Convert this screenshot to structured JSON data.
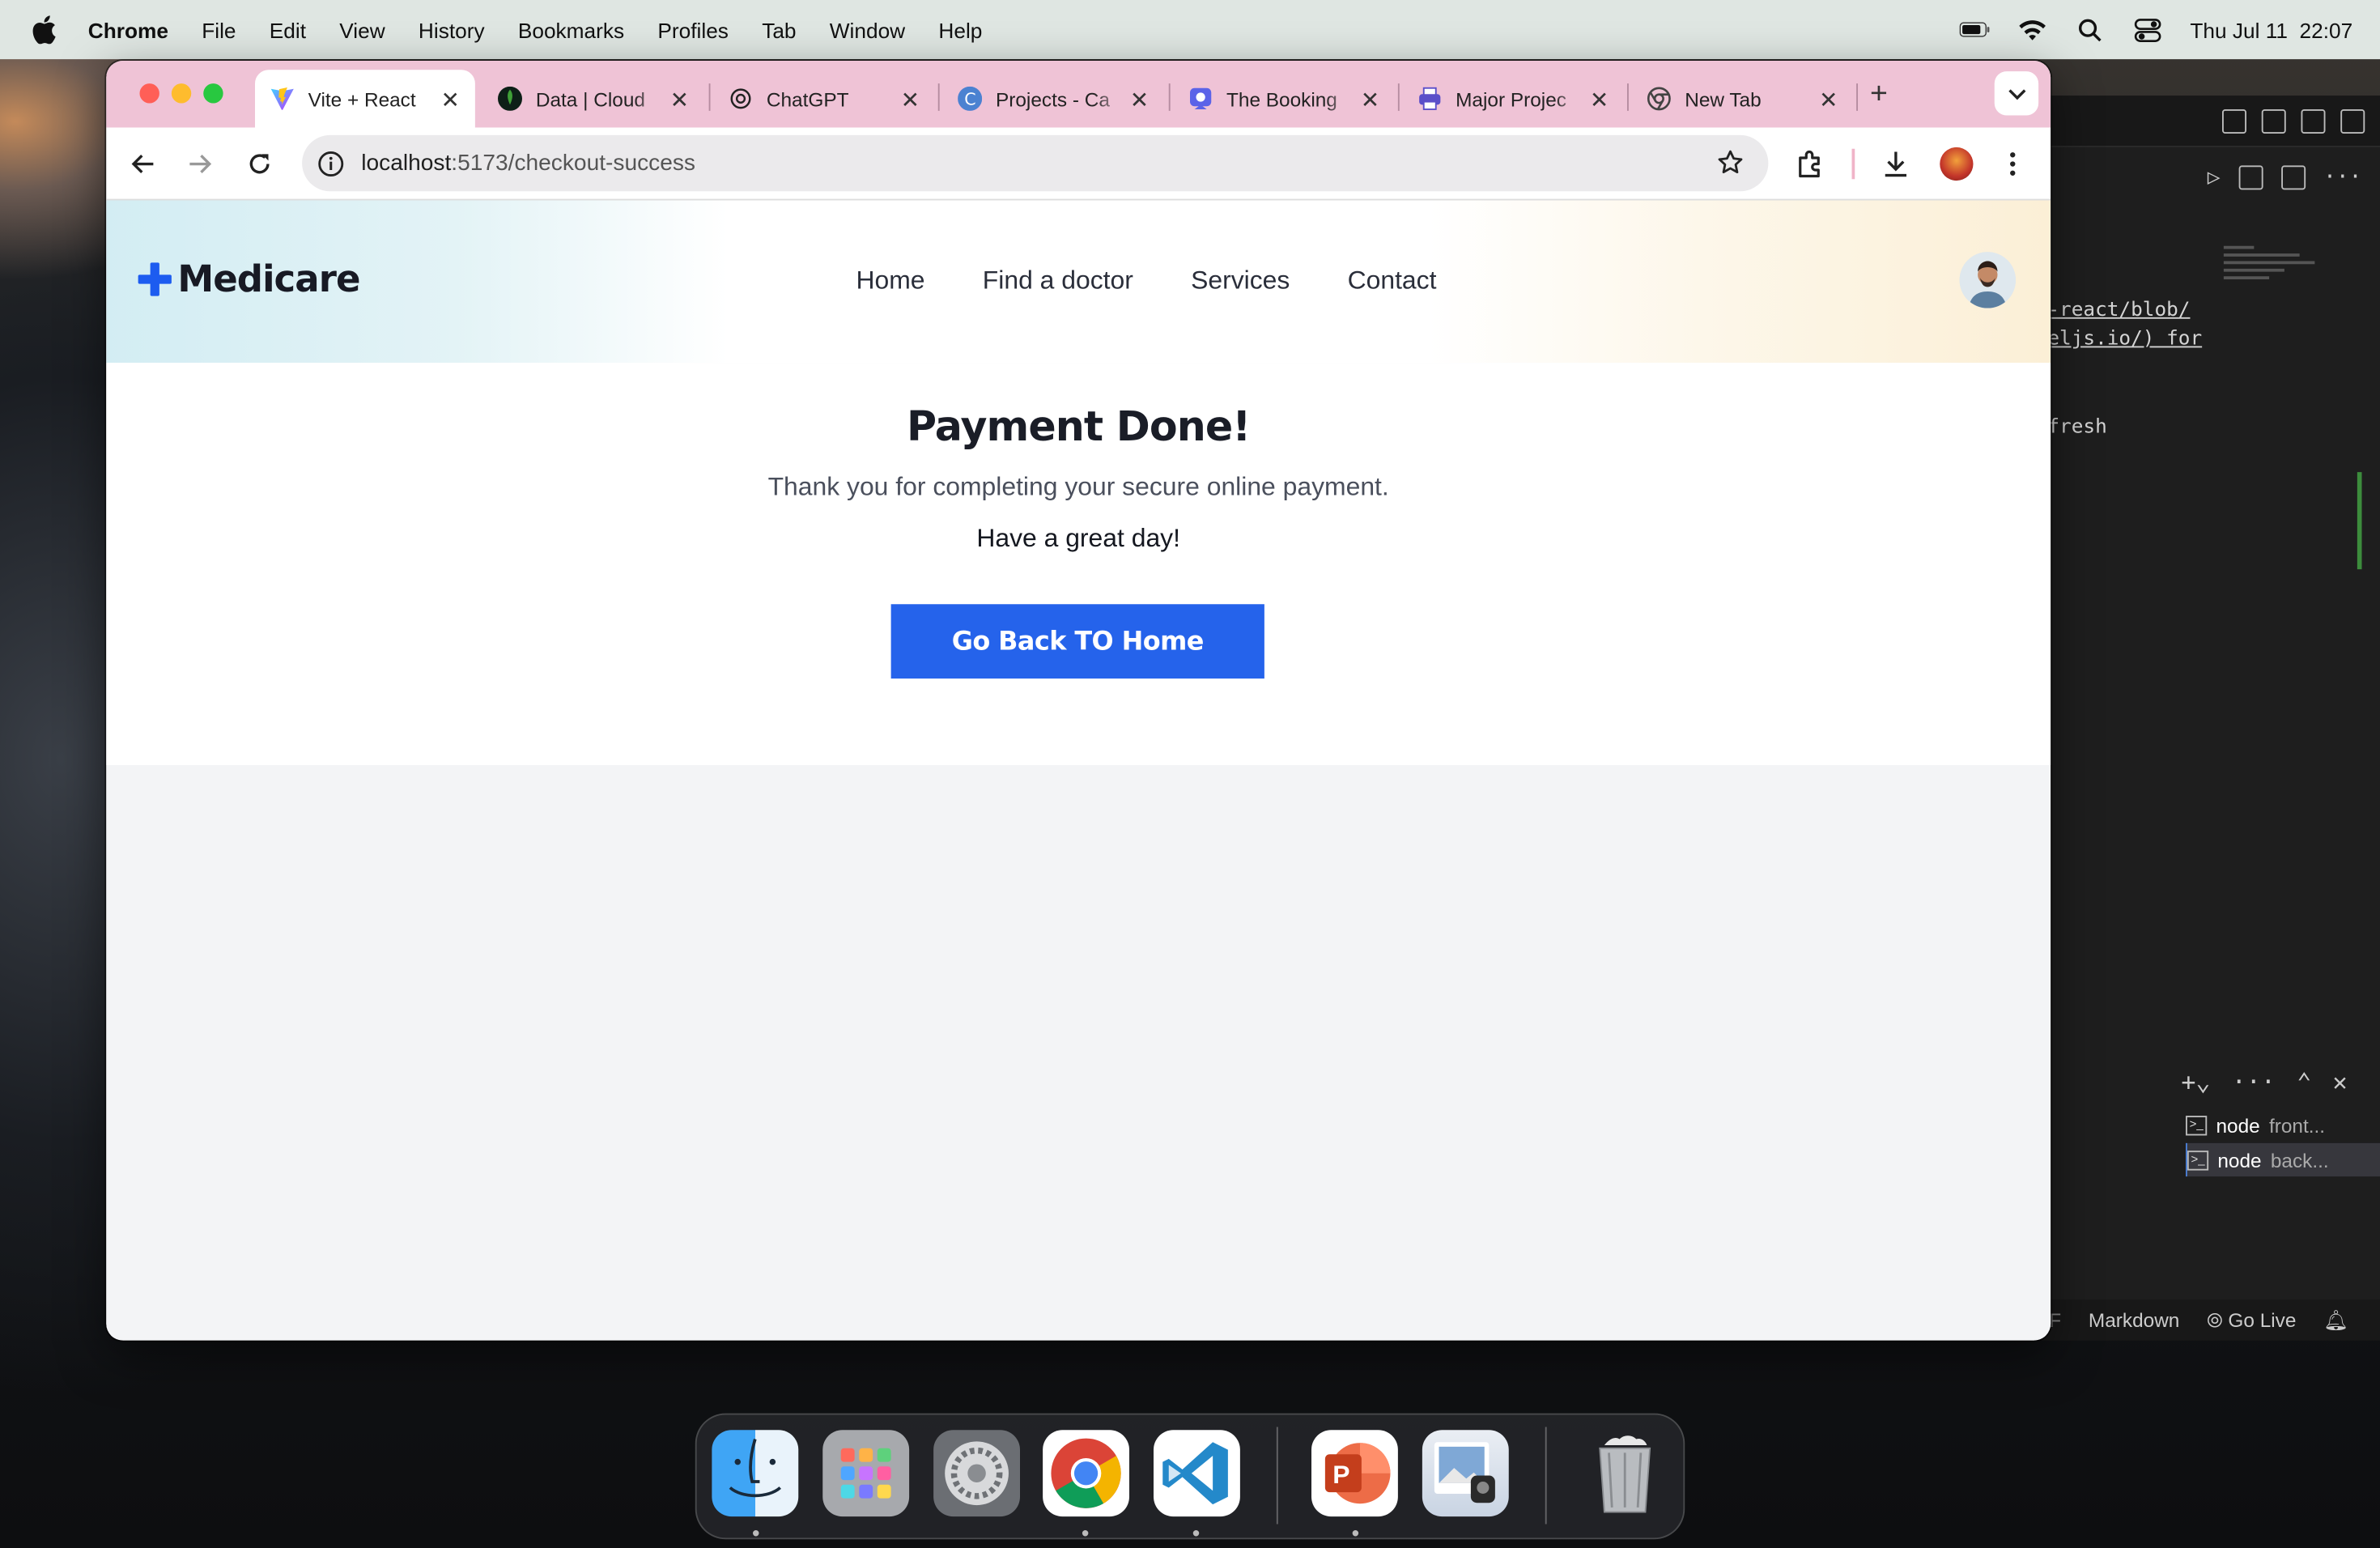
{
  "menubar": {
    "app_name": "Chrome",
    "items": [
      "File",
      "Edit",
      "View",
      "History",
      "Bookmarks",
      "Profiles",
      "Tab",
      "Window",
      "Help"
    ],
    "clock": "Thu Jul 11  22:07"
  },
  "browser": {
    "tabs": [
      {
        "title": "Vite + React",
        "icon": "vite-icon",
        "active": true
      },
      {
        "title": "Data | Cloud",
        "icon": "mongodb-leaf-icon",
        "active": false
      },
      {
        "title": "ChatGPT",
        "icon": "chatgpt-icon",
        "active": false
      },
      {
        "title": "Projects - Ca",
        "icon": "canva-icon",
        "active": false
      },
      {
        "title": "The Booking",
        "icon": "booking-icon",
        "active": false
      },
      {
        "title": "Major Projec",
        "icon": "printer-icon",
        "active": false
      },
      {
        "title": "New Tab",
        "icon": "chrome-icon",
        "active": false
      }
    ],
    "url_host": "localhost",
    "url_path": ":5173/checkout-success"
  },
  "site": {
    "logo": "Medicare",
    "nav": [
      "Home",
      "Find a doctor",
      "Services",
      "Contact"
    ]
  },
  "success": {
    "title": "Payment Done!",
    "message": "Thank you for completing your secure online payment.",
    "greeting": "Have a great day!",
    "button": "Go Back TO Home"
  },
  "vscode": {
    "code_lines": [
      "-react/blob/",
      "eljs.io/) for",
      "fresh"
    ],
    "terminals": [
      {
        "name": "node",
        "detail": "front..."
      },
      {
        "name": "node",
        "detail": "back..."
      }
    ],
    "status": [
      "F",
      "Markdown",
      "Go Live"
    ]
  },
  "dock": [
    "Finder",
    "Launchpad",
    "System Settings",
    "Google Chrome",
    "Visual Studio Code",
    "Microsoft PowerPoint",
    "Preview",
    "Trash"
  ],
  "colors": {
    "accent": "#2563eb",
    "tabstrip": "#efc3d6",
    "logo_plus": "#1d5cf0"
  }
}
